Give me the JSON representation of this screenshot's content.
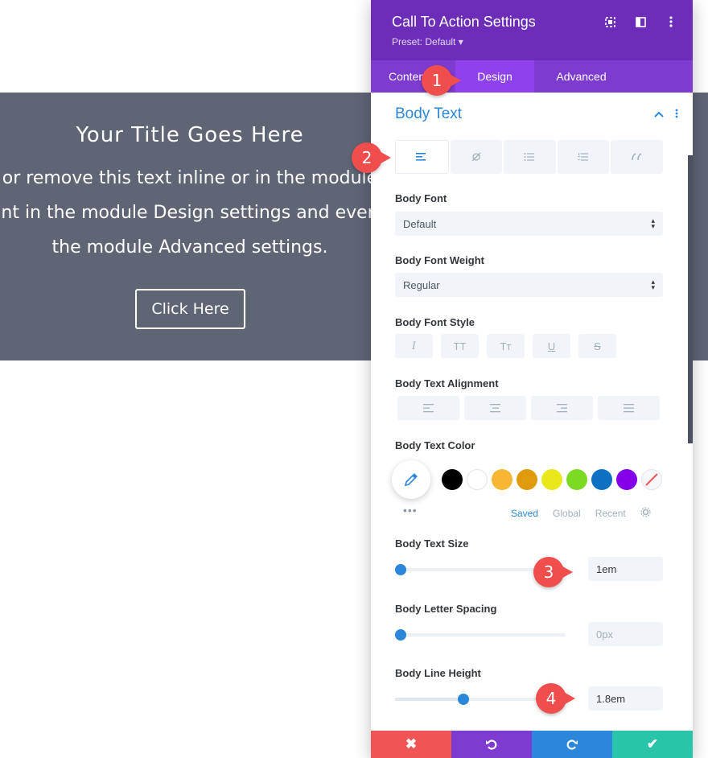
{
  "cta": {
    "title": "Your Title Goes Here",
    "body_lines": [
      "or remove this text inline or in the module",
      "nt in the module Design settings and even",
      "the module Advanced settings."
    ],
    "button_label": "Click Here"
  },
  "panel": {
    "title": "Call To Action Settings",
    "preset": "Preset: Default ▾",
    "tabs": [
      "Content",
      "Design",
      "Advanced"
    ],
    "section_title": "Body Text",
    "body_font": {
      "label": "Body Font",
      "value": "Default"
    },
    "body_font_weight": {
      "label": "Body Font Weight",
      "value": "Regular"
    },
    "body_font_style": {
      "label": "Body Font Style",
      "buttons": [
        "I",
        "TT",
        "Tт",
        "U",
        "S"
      ]
    },
    "body_text_alignment": {
      "label": "Body Text Alignment"
    },
    "body_text_color": {
      "label": "Body Text Color",
      "swatches": [
        "#000000",
        "#ffffff",
        "#f6b533",
        "#e09a0e",
        "#e8e81a",
        "#7cda24",
        "#0c71c3",
        "#8300e9"
      ],
      "palette_tabs": [
        "Saved",
        "Global",
        "Recent"
      ]
    },
    "body_text_size": {
      "label": "Body Text Size",
      "value": "1em",
      "slider_fraction": 0.0
    },
    "body_letter_spacing": {
      "label": "Body Letter Spacing",
      "value": "0px",
      "slider_fraction": 0.0
    },
    "body_line_height": {
      "label": "Body Line Height",
      "value": "1.8em",
      "slider_fraction": 0.4
    }
  },
  "callouts": [
    "1",
    "2",
    "3",
    "4"
  ],
  "colors": {
    "header": "#6c2eb9",
    "accent": "#2b87da",
    "cancel": "#ef5555",
    "undo": "#7e3bd0",
    "redo": "#2b87da",
    "save": "#29c4a9"
  }
}
